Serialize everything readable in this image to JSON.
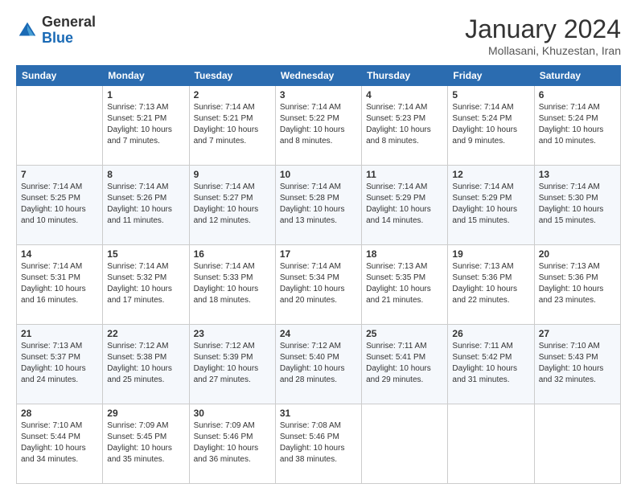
{
  "header": {
    "logo_general": "General",
    "logo_blue": "Blue",
    "month_title": "January 2024",
    "location": "Mollasani, Khuzestan, Iran"
  },
  "days_of_week": [
    "Sunday",
    "Monday",
    "Tuesday",
    "Wednesday",
    "Thursday",
    "Friday",
    "Saturday"
  ],
  "weeks": [
    [
      {
        "day": "",
        "info": ""
      },
      {
        "day": "1",
        "info": "Sunrise: 7:13 AM\nSunset: 5:21 PM\nDaylight: 10 hours\nand 7 minutes."
      },
      {
        "day": "2",
        "info": "Sunrise: 7:14 AM\nSunset: 5:21 PM\nDaylight: 10 hours\nand 7 minutes."
      },
      {
        "day": "3",
        "info": "Sunrise: 7:14 AM\nSunset: 5:22 PM\nDaylight: 10 hours\nand 8 minutes."
      },
      {
        "day": "4",
        "info": "Sunrise: 7:14 AM\nSunset: 5:23 PM\nDaylight: 10 hours\nand 8 minutes."
      },
      {
        "day": "5",
        "info": "Sunrise: 7:14 AM\nSunset: 5:24 PM\nDaylight: 10 hours\nand 9 minutes."
      },
      {
        "day": "6",
        "info": "Sunrise: 7:14 AM\nSunset: 5:24 PM\nDaylight: 10 hours\nand 10 minutes."
      }
    ],
    [
      {
        "day": "7",
        "info": "Sunrise: 7:14 AM\nSunset: 5:25 PM\nDaylight: 10 hours\nand 10 minutes."
      },
      {
        "day": "8",
        "info": "Sunrise: 7:14 AM\nSunset: 5:26 PM\nDaylight: 10 hours\nand 11 minutes."
      },
      {
        "day": "9",
        "info": "Sunrise: 7:14 AM\nSunset: 5:27 PM\nDaylight: 10 hours\nand 12 minutes."
      },
      {
        "day": "10",
        "info": "Sunrise: 7:14 AM\nSunset: 5:28 PM\nDaylight: 10 hours\nand 13 minutes."
      },
      {
        "day": "11",
        "info": "Sunrise: 7:14 AM\nSunset: 5:29 PM\nDaylight: 10 hours\nand 14 minutes."
      },
      {
        "day": "12",
        "info": "Sunrise: 7:14 AM\nSunset: 5:29 PM\nDaylight: 10 hours\nand 15 minutes."
      },
      {
        "day": "13",
        "info": "Sunrise: 7:14 AM\nSunset: 5:30 PM\nDaylight: 10 hours\nand 15 minutes."
      }
    ],
    [
      {
        "day": "14",
        "info": "Sunrise: 7:14 AM\nSunset: 5:31 PM\nDaylight: 10 hours\nand 16 minutes."
      },
      {
        "day": "15",
        "info": "Sunrise: 7:14 AM\nSunset: 5:32 PM\nDaylight: 10 hours\nand 17 minutes."
      },
      {
        "day": "16",
        "info": "Sunrise: 7:14 AM\nSunset: 5:33 PM\nDaylight: 10 hours\nand 18 minutes."
      },
      {
        "day": "17",
        "info": "Sunrise: 7:14 AM\nSunset: 5:34 PM\nDaylight: 10 hours\nand 20 minutes."
      },
      {
        "day": "18",
        "info": "Sunrise: 7:13 AM\nSunset: 5:35 PM\nDaylight: 10 hours\nand 21 minutes."
      },
      {
        "day": "19",
        "info": "Sunrise: 7:13 AM\nSunset: 5:36 PM\nDaylight: 10 hours\nand 22 minutes."
      },
      {
        "day": "20",
        "info": "Sunrise: 7:13 AM\nSunset: 5:36 PM\nDaylight: 10 hours\nand 23 minutes."
      }
    ],
    [
      {
        "day": "21",
        "info": "Sunrise: 7:13 AM\nSunset: 5:37 PM\nDaylight: 10 hours\nand 24 minutes."
      },
      {
        "day": "22",
        "info": "Sunrise: 7:12 AM\nSunset: 5:38 PM\nDaylight: 10 hours\nand 25 minutes."
      },
      {
        "day": "23",
        "info": "Sunrise: 7:12 AM\nSunset: 5:39 PM\nDaylight: 10 hours\nand 27 minutes."
      },
      {
        "day": "24",
        "info": "Sunrise: 7:12 AM\nSunset: 5:40 PM\nDaylight: 10 hours\nand 28 minutes."
      },
      {
        "day": "25",
        "info": "Sunrise: 7:11 AM\nSunset: 5:41 PM\nDaylight: 10 hours\nand 29 minutes."
      },
      {
        "day": "26",
        "info": "Sunrise: 7:11 AM\nSunset: 5:42 PM\nDaylight: 10 hours\nand 31 minutes."
      },
      {
        "day": "27",
        "info": "Sunrise: 7:10 AM\nSunset: 5:43 PM\nDaylight: 10 hours\nand 32 minutes."
      }
    ],
    [
      {
        "day": "28",
        "info": "Sunrise: 7:10 AM\nSunset: 5:44 PM\nDaylight: 10 hours\nand 34 minutes."
      },
      {
        "day": "29",
        "info": "Sunrise: 7:09 AM\nSunset: 5:45 PM\nDaylight: 10 hours\nand 35 minutes."
      },
      {
        "day": "30",
        "info": "Sunrise: 7:09 AM\nSunset: 5:46 PM\nDaylight: 10 hours\nand 36 minutes."
      },
      {
        "day": "31",
        "info": "Sunrise: 7:08 AM\nSunset: 5:46 PM\nDaylight: 10 hours\nand 38 minutes."
      },
      {
        "day": "",
        "info": ""
      },
      {
        "day": "",
        "info": ""
      },
      {
        "day": "",
        "info": ""
      }
    ]
  ]
}
